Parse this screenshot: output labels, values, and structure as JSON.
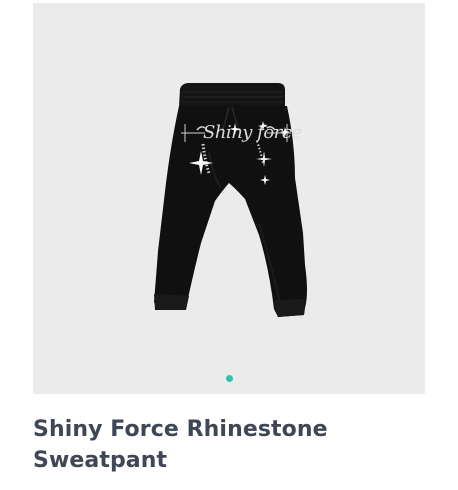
{
  "product": {
    "title": "Shiny Force Rhinestone Sweatpant",
    "image_print_text": "Shiny force",
    "carousel": {
      "total_slides": 1,
      "active_slide": 1
    }
  },
  "colors": {
    "image_background": "#ebebeb",
    "garment": "#0f0f0f",
    "rhinestone": "#d8d8d8",
    "active_dot": "#34c1a6",
    "title_text": "#3d4756"
  }
}
